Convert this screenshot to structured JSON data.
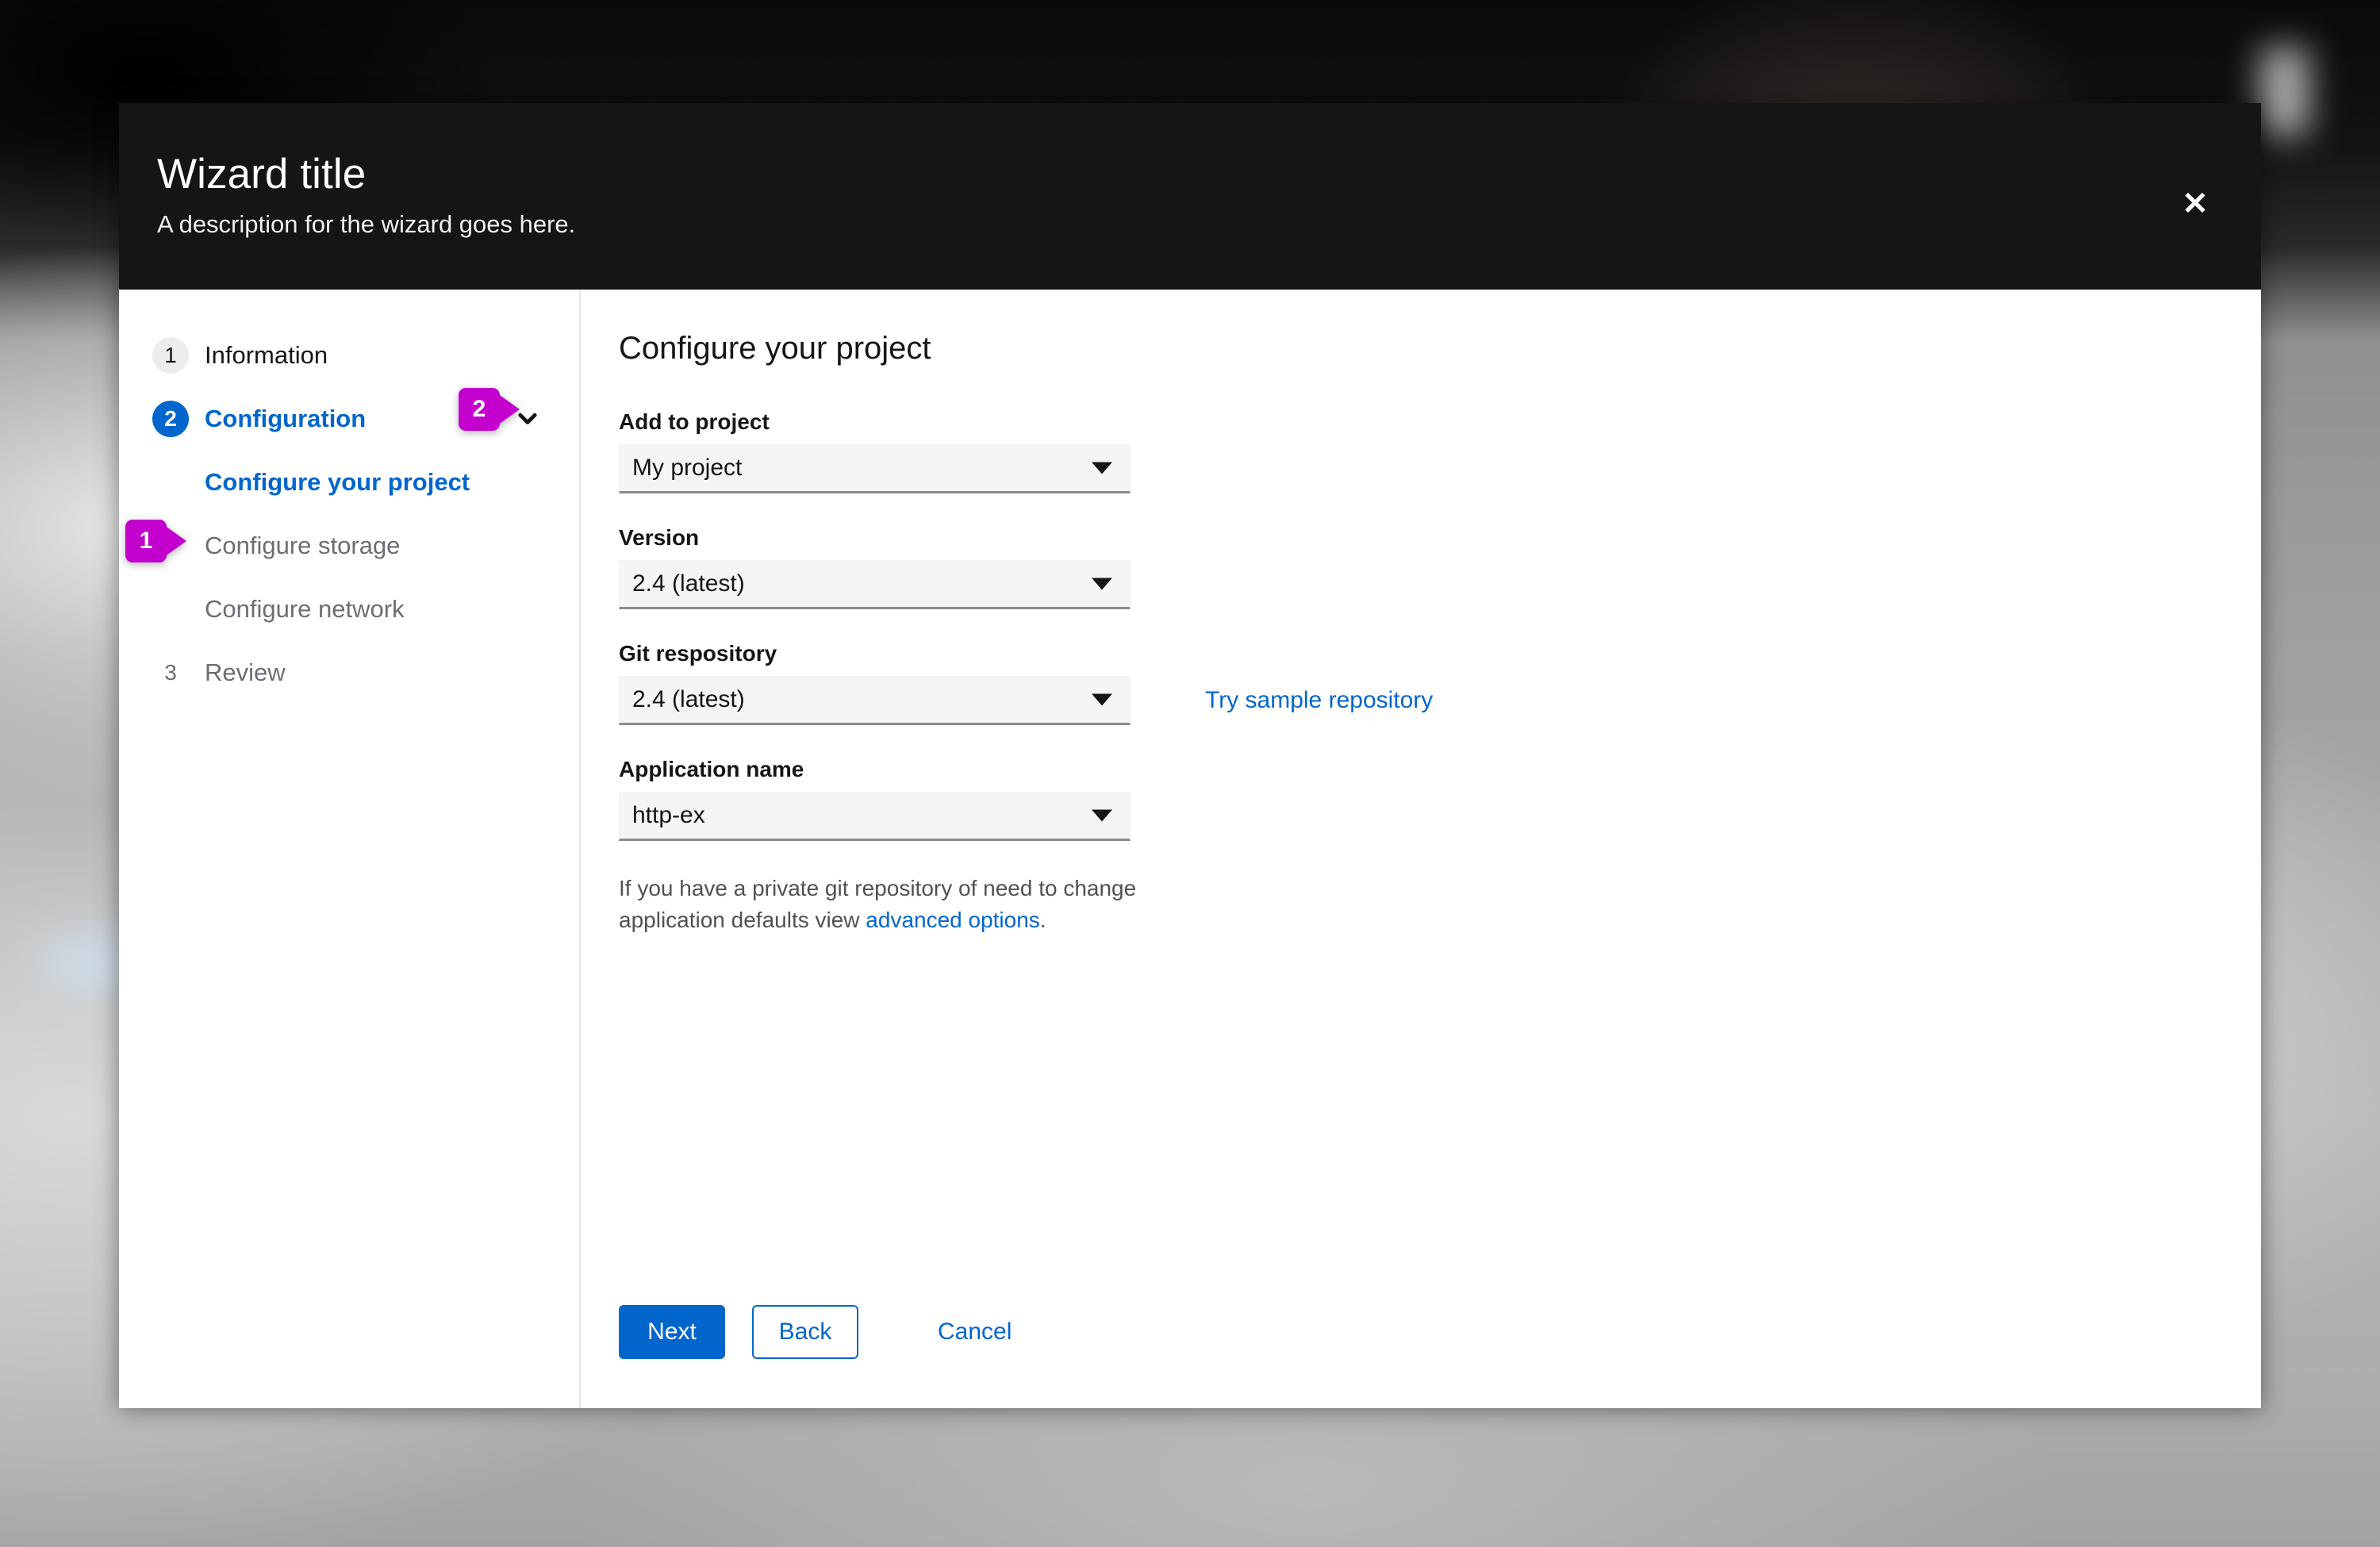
{
  "header": {
    "title": "Wizard title",
    "description": "A description for the wizard goes here.",
    "close_label": "✕"
  },
  "nav": {
    "steps": [
      {
        "number": "1",
        "label": "Information",
        "state": "inactive"
      },
      {
        "number": "2",
        "label": "Configuration",
        "state": "active"
      },
      {
        "number": "3",
        "label": "Review",
        "state": "pending"
      }
    ],
    "substeps": [
      {
        "label": "Configure your project",
        "state": "active"
      },
      {
        "label": "Configure storage",
        "state": "inactive"
      },
      {
        "label": "Configure network",
        "state": "inactive"
      }
    ],
    "toggle_icon": "chevron-down"
  },
  "annotations": [
    {
      "id": "1",
      "text": "1"
    },
    {
      "id": "2",
      "text": "2"
    }
  ],
  "main": {
    "title": "Configure your project",
    "fields": [
      {
        "label": "Add to project",
        "value": "My project"
      },
      {
        "label": "Version",
        "value": "2.4 (latest)"
      },
      {
        "label": "Git respository",
        "value": "2.4 (latest)",
        "side_link": "Try sample repository"
      },
      {
        "label": "Application name",
        "value": "http-ex"
      }
    ],
    "help": {
      "before": "If you have a private git repository of need to change application defaults view ",
      "link": "advanced options",
      "after": "."
    }
  },
  "footer": {
    "next_label": "Next",
    "back_label": "Back",
    "cancel_label": "Cancel"
  },
  "colors": {
    "accent": "#0066cc",
    "annotation": "#c300cd",
    "header_bg": "#151515",
    "muted_text": "#6a6e73"
  }
}
